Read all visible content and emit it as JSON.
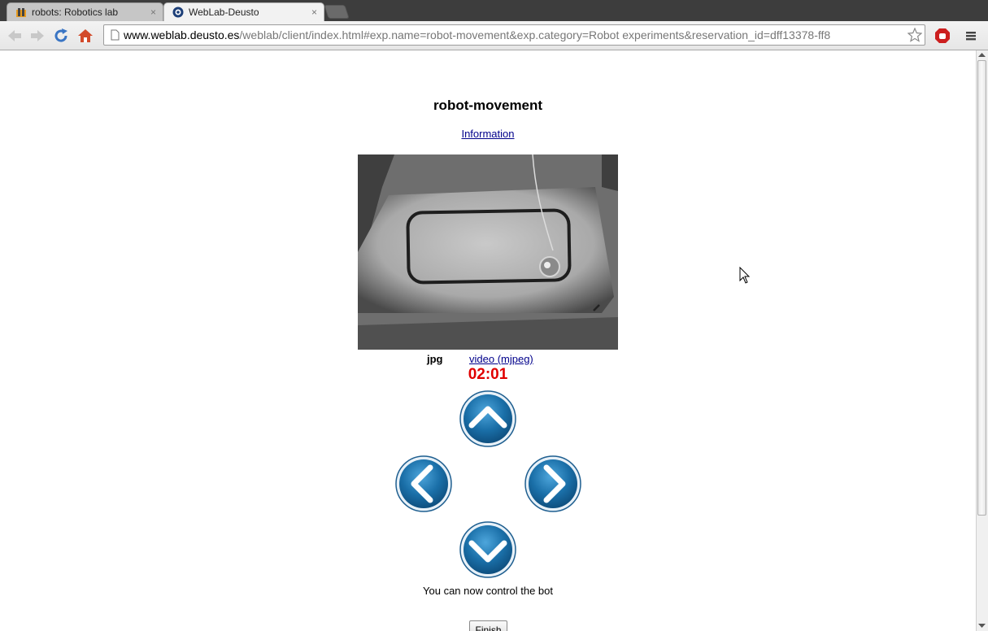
{
  "browser": {
    "tabs": [
      {
        "title": "robots: Robotics lab",
        "active": false,
        "icon": "folder-moodle-icon"
      },
      {
        "title": "WebLab-Deusto",
        "active": true,
        "icon": "weblab-icon"
      }
    ],
    "close_glyph": "×",
    "address": {
      "host": "www.weblab.deusto.es",
      "path": "/weblab/client/index.html#exp.name=robot-movement&exp.category=Robot experiments&reservation_id=dff13378-ff8"
    }
  },
  "page": {
    "title": "robot-movement",
    "info_link": "Information",
    "camera": {
      "formats": {
        "jpg": "jpg",
        "video": "video (mjpeg)"
      }
    },
    "timer": "02:01",
    "controls": [
      "up",
      "left",
      "right",
      "down"
    ],
    "status": "You can now control the bot",
    "finish_label": "Finish"
  },
  "colors": {
    "timer": "#e00000",
    "link": "#00008b",
    "button_blue": "#1a6fa8",
    "tabstrip": "#3d3d3d"
  }
}
